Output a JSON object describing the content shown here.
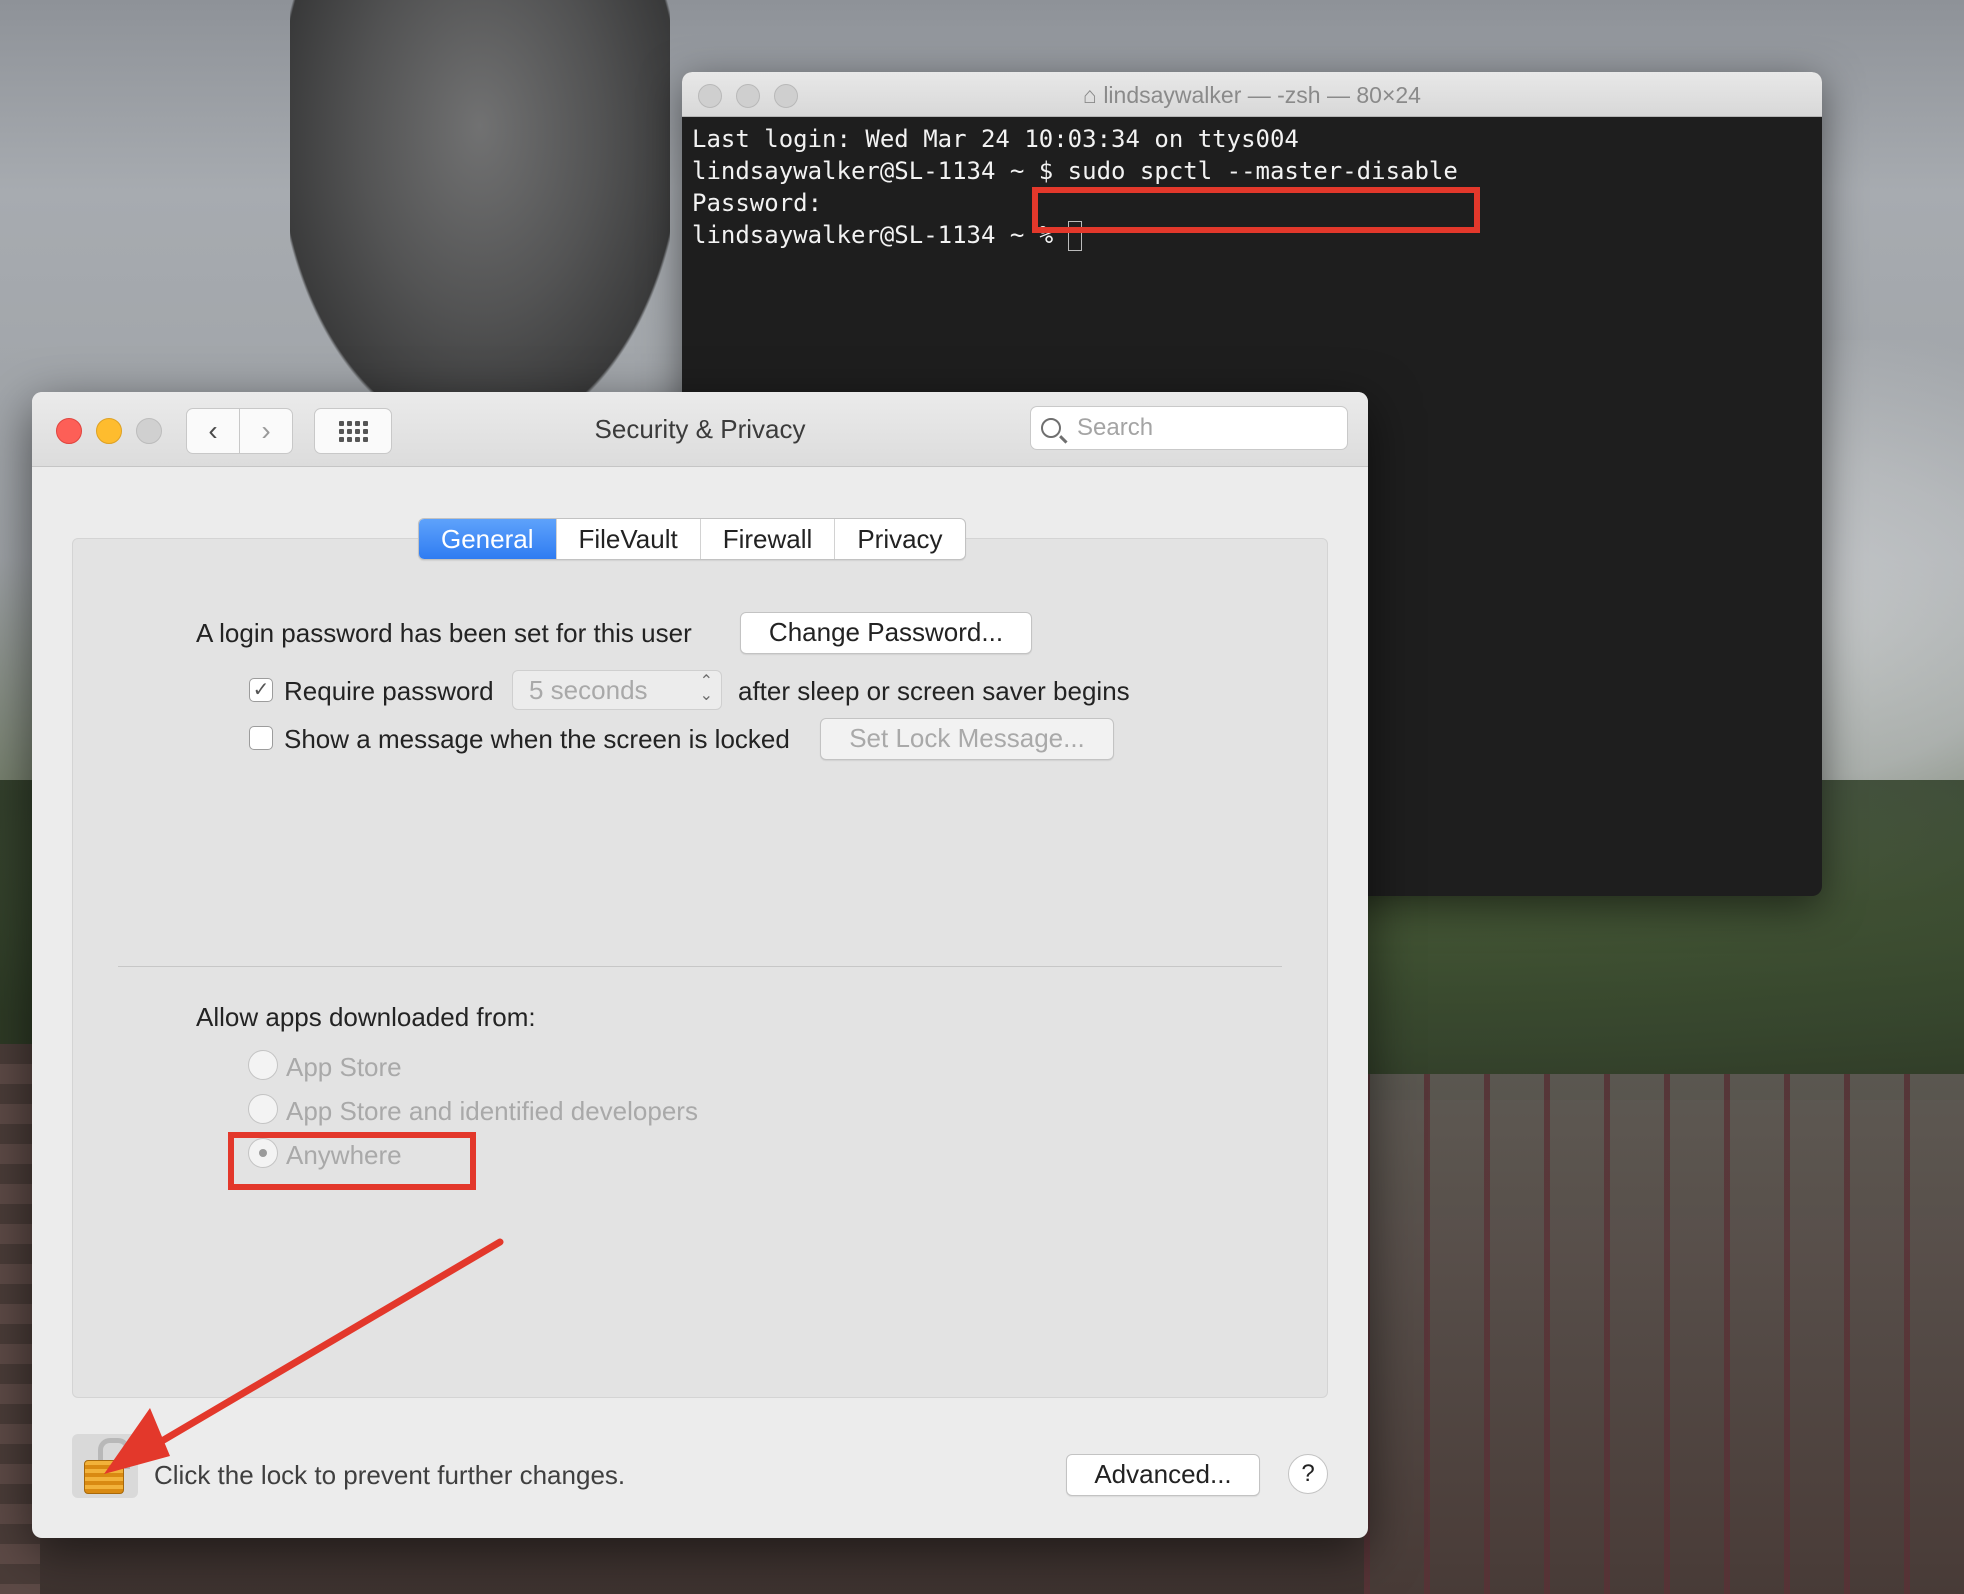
{
  "terminal": {
    "title": "lindsaywalker — -zsh — 80×24",
    "lines": [
      "Last login: Wed Mar 24 10:03:34 on ttys004",
      "lindsaywalker@SL-1134 ~ $ sudo spctl --master-disable",
      "Password:",
      "lindsaywalker@SL-1134 ~ % "
    ]
  },
  "prefs": {
    "title": "Security & Privacy",
    "search_placeholder": "Search",
    "tabs": [
      "General",
      "FileVault",
      "Firewall",
      "Privacy"
    ],
    "active_tab": "General",
    "login_text": "A login password has been set for this user",
    "change_password": "Change Password...",
    "require_password_label": "Require password",
    "require_password_checked": true,
    "require_password_value": "5 seconds",
    "after_sleep": "after sleep or screen saver begins",
    "show_message_label": "Show a message when the screen is locked",
    "set_lock_message": "Set Lock Message...",
    "allow_apps_label": "Allow apps downloaded from:",
    "options": [
      "App Store",
      "App Store and identified developers",
      "Anywhere"
    ],
    "selected_option": "Anywhere",
    "lock_text": "Click the lock to prevent further changes.",
    "advanced": "Advanced...",
    "help": "?"
  },
  "annotations": {
    "highlight_color": "#e3382b"
  }
}
